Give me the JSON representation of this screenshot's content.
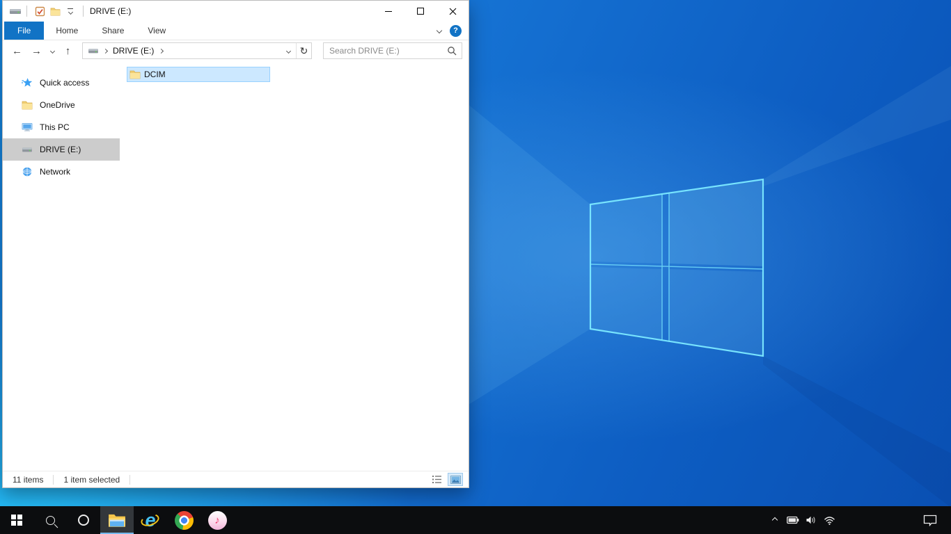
{
  "colors": {
    "file_tab_blue": "#1173c5",
    "selection_bg": "#cce8ff",
    "selection_border": "#99d1ff",
    "sidebar_selected_bg": "#cccccc",
    "taskbar_bg": "#0c0d0f",
    "taskbar_active_underline": "#76b9ed",
    "wallpaper_logo_edge": "#7ce9ff"
  },
  "icons": {
    "back": "←",
    "forward": "→",
    "up": "↑",
    "refresh": "↻",
    "help": "?",
    "ie_letter": "e",
    "itunes_note": "♪"
  },
  "window": {
    "title": "DRIVE (E:)",
    "tabs": {
      "file": "File",
      "home": "Home",
      "share": "Share",
      "view": "View"
    },
    "address": {
      "crumb": "DRIVE (E:)"
    },
    "search_placeholder": "Search DRIVE (E:)",
    "sidebar": {
      "items": [
        {
          "label": "Quick access"
        },
        {
          "label": "OneDrive"
        },
        {
          "label": "This PC"
        },
        {
          "label": "DRIVE (E:)"
        },
        {
          "label": "Network"
        }
      ]
    },
    "files": [
      {
        "name": "DCIM"
      }
    ],
    "status": {
      "items": "11 items",
      "selected": "1 item selected"
    }
  },
  "taskbar": {
    "apps": [
      "start",
      "search",
      "cortana",
      "file-explorer",
      "internet-explorer",
      "chrome",
      "itunes"
    ],
    "active_app": "file-explorer",
    "tray": [
      "hidden-icons-chevron",
      "battery",
      "speaker",
      "wifi",
      "action-center"
    ]
  }
}
